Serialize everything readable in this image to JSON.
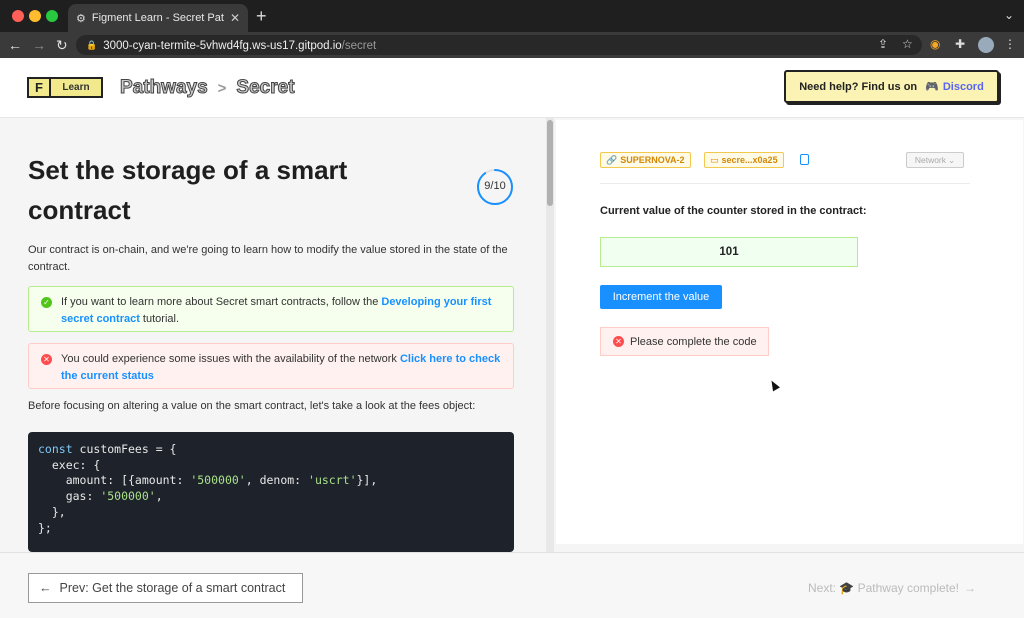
{
  "browser": {
    "tab_title": "Figment Learn - Secret Pathway",
    "url_host": "3000-cyan-termite-5vhwd4fg.ws-us17.gitpod.io",
    "url_path": "/secret"
  },
  "header": {
    "logo_letter": "F",
    "logo_text": "Learn",
    "crumb_1": "Pathways",
    "crumb_sep": ">",
    "crumb_2": "Secret",
    "help_text": "Need help? Find us on",
    "discord_label": "Discord"
  },
  "lesson": {
    "title": "Set the storage of a smart contract",
    "progress": "9/10",
    "progress_fraction": 0.9,
    "intro": "Our contract is on-chain, and we're going to learn how to modify the value stored in the state of the contract.",
    "info_before": "If you want to learn more about Secret smart contracts, follow the ",
    "info_link": "Developing your first secret contract",
    "info_after": " tutorial.",
    "warn_before": "You could experience some issues with the availability of the network ",
    "warn_link": "Click here to check the current status",
    "before_code": "Before focusing on altering a value on the smart contract, let's take a look at the fees object:",
    "code_lines": [
      "const customFees = {",
      "  exec: {",
      "    amount: [{amount: '500000', denom: 'uscrt'}],",
      "    gas: '500000',",
      "  },",
      "};"
    ]
  },
  "panel": {
    "network_chip": "SUPERNOVA-2",
    "address_chip": "secre...x0a25",
    "network_select": "Network",
    "counter_label": "Current value of the counter stored in the contract:",
    "counter_value": "101",
    "increment_button": "Increment the value",
    "error_text": "Please complete the code"
  },
  "footer": {
    "prev_label": "Prev: Get the storage of a smart contract",
    "next_label": "Next: 🎓 Pathway complete!"
  },
  "colors": {
    "accent": "#1890ff",
    "success_bg": "#f6ffed",
    "error_bg": "#fff1f0",
    "logo_yellow": "#f1e98c",
    "help_yellow": "#faf3b3"
  }
}
